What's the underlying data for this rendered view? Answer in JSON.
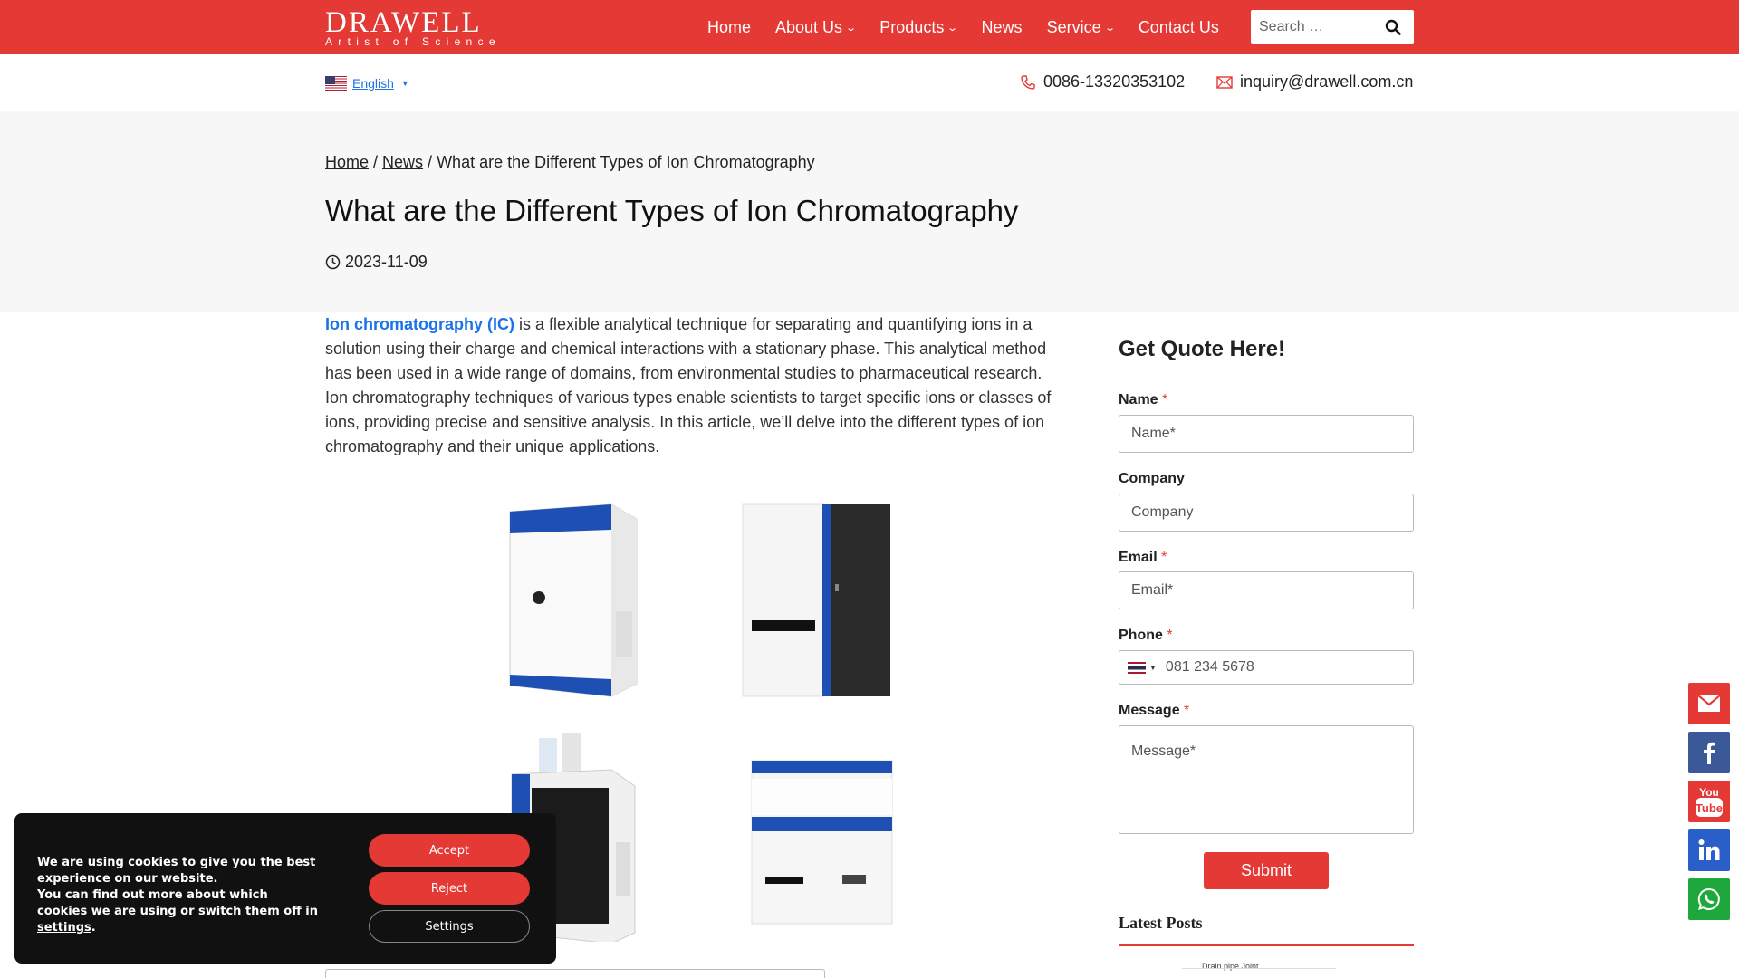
{
  "header": {
    "logo_main": "DRAWELL",
    "logo_sub": "Artist of Science",
    "nav": [
      {
        "label": "Home",
        "dropdown": false
      },
      {
        "label": "About Us",
        "dropdown": true
      },
      {
        "label": "Products",
        "dropdown": true
      },
      {
        "label": "News",
        "dropdown": false
      },
      {
        "label": "Service",
        "dropdown": true
      },
      {
        "label": "Contact Us",
        "dropdown": false
      }
    ],
    "search_placeholder": "Search …"
  },
  "subbar": {
    "language": "English",
    "phone": "0086-13320353102",
    "email": "inquiry@drawell.com.cn"
  },
  "breadcrumb": {
    "home": "Home",
    "sep1": " / ",
    "news": "News",
    "sep2": " / ",
    "current": "What are the Different Types of Ion Chromatography"
  },
  "post": {
    "title": "What are the Different Types of Ion Chromatography",
    "date": "2023-11-09",
    "intro_link": "Ion chromatography (IC)",
    "intro_text": " is a flexible analytical technique for separating and quantifying ions in a solution using their charge and chemical interactions with a stationary phase. This analytical method has been used in a wide range of domains, from environmental studies to pharmaceutical research. Ion chromatography techniques of various types enable scientists to target specific ions or classes of ions, providing precise and sensitive analysis. In this article, we’ll delve into the different types of ion chromatography and their unique applications."
  },
  "form": {
    "title": "Get Quote Here!",
    "name_label": "Name",
    "name_placeholder": "Name*",
    "company_label": "Company",
    "company_placeholder": "Company",
    "email_label": "Email",
    "email_placeholder": "Email*",
    "phone_label": "Phone",
    "phone_placeholder": "081 234 5678",
    "message_label": "Message",
    "message_placeholder": "Message*",
    "required_mark": "*",
    "submit": "Submit"
  },
  "sidebar": {
    "latest_title": "Latest Posts",
    "thumb_caption": "Drain pipe Joint"
  },
  "cookie": {
    "line1": "We are using cookies to give you the best experience on our website.",
    "line2_before": "You can find out more about which cookies we are using or switch them off in ",
    "line2_link": "settings",
    "line2_after": ".",
    "accept": "Accept",
    "reject": "Reject",
    "settings": "Settings"
  },
  "social": [
    {
      "icon": "mail-icon",
      "color": "#e53935"
    },
    {
      "icon": "facebook-icon",
      "color": "#3b5998"
    },
    {
      "icon": "youtube-icon",
      "color": "#e53935"
    },
    {
      "icon": "linkedin-icon",
      "color": "#2a5ec8"
    },
    {
      "icon": "whatsapp-icon",
      "color": "#1ea83c"
    }
  ],
  "colors": {
    "brand_red": "#e53935",
    "link_blue": "#1a73e8"
  }
}
